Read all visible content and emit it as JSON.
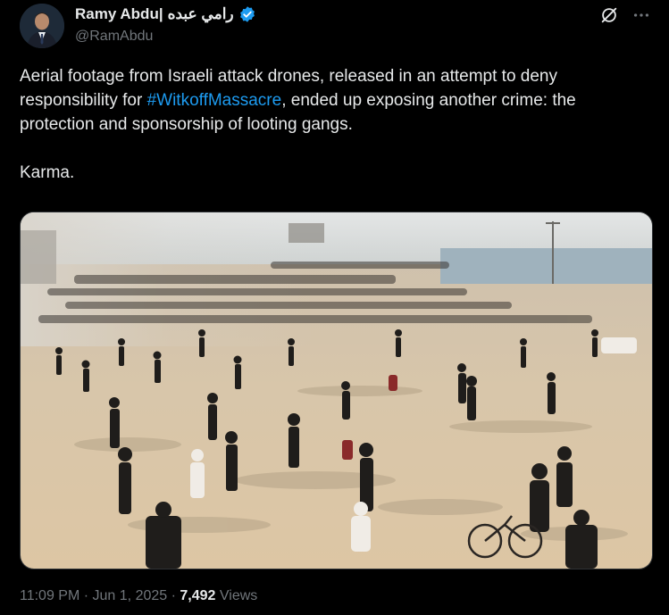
{
  "author": {
    "display_name_latin": "Ramy Abdu|",
    "display_name_arabic": "رامي عبده",
    "handle": "@RamAbdu",
    "verified": true,
    "verified_color": "#1d9bf0"
  },
  "tweet": {
    "text_before_hashtag": "Aerial footage from Israeli attack drones, released in an attempt to deny responsibility for ",
    "hashtag": "#WitkoffMassacre",
    "text_after_hashtag": ", ended up exposing another crime: the protection and sponsorship of looting gangs.",
    "second_paragraph": "Karma."
  },
  "meta": {
    "time": "11:09 PM",
    "separator": "·",
    "date": "Jun 1, 2025",
    "views_count": "7,492",
    "views_label": "Views"
  },
  "icons": {
    "top_right": [
      "grok-icon",
      "more-icon"
    ]
  },
  "colors": {
    "background": "#000000",
    "text_primary": "#e7e9ea",
    "text_secondary": "#71767b",
    "link": "#1d9bf0"
  }
}
